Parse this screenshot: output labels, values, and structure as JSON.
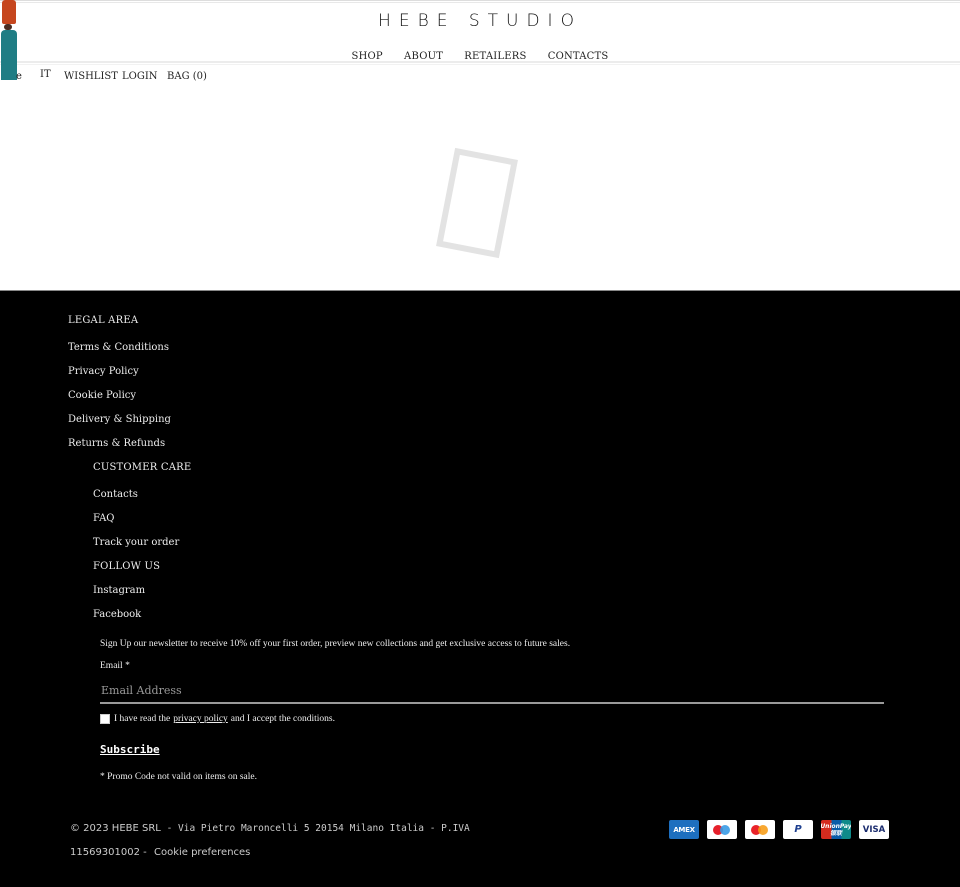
{
  "header": {
    "logo": "HEBE STUDIO",
    "main_nav": [
      "SHOP",
      "ABOUT",
      "RETAILERS",
      "CONTACTS"
    ],
    "util_nav": {
      "lang_en_partial": "e",
      "lang_it": "IT",
      "wishlist": "WISHLIST",
      "login": "LOGIN",
      "bag": "BAG (0)"
    }
  },
  "footer": {
    "legal": {
      "heading": "LEGAL AREA",
      "links": [
        "Terms & Conditions",
        "Privacy Policy",
        "Cookie Policy",
        "Delivery & Shipping",
        "Returns & Refunds"
      ]
    },
    "customer_care": {
      "heading": "CUSTOMER CARE",
      "links": [
        "Contacts",
        "FAQ",
        "Track your order"
      ]
    },
    "follow": {
      "heading": "FOLLOW US",
      "links": [
        "Instagram",
        "Facebook"
      ]
    },
    "newsletter": {
      "intro": "Sign Up our newsletter to receive 10% off your first order, preview new collections and get exclusive access to future sales.",
      "email_label": "Email *",
      "email_placeholder": "Email Address",
      "email_value": "",
      "consent_before": "I have read the",
      "consent_link": "privacy policy",
      "consent_after": "and I accept the conditions.",
      "consent_checked": false,
      "subscribe_label": "Subscribe",
      "promo_note": "* Promo Code not valid on items on sale."
    },
    "copyright": {
      "line1_prefix": "© 2023 HEBE SRL",
      "line1_rest": " - Via Pietro Maroncelli 5 20154 Milano Italia - P.IVA",
      "line2_vat": "11569301002 -",
      "cookie_preferences": "Cookie preferences"
    },
    "payments": {
      "amex": "AMEX",
      "maestro": "Maestro",
      "mastercard": "Mastercard",
      "paypal": "P",
      "unionpay_line1": "UnionPay",
      "unionpay_line2": "银联",
      "visa": "VISA"
    }
  },
  "colors": {
    "footer_bg": "#000000",
    "loader": "#e3e3e3",
    "amex_blue": "#1d6fbf",
    "maestro_red": "#e6202b",
    "maestro_blue": "#3a9be6",
    "mastercard_red": "#e9232a",
    "mastercard_orange": "#f79e1b"
  }
}
